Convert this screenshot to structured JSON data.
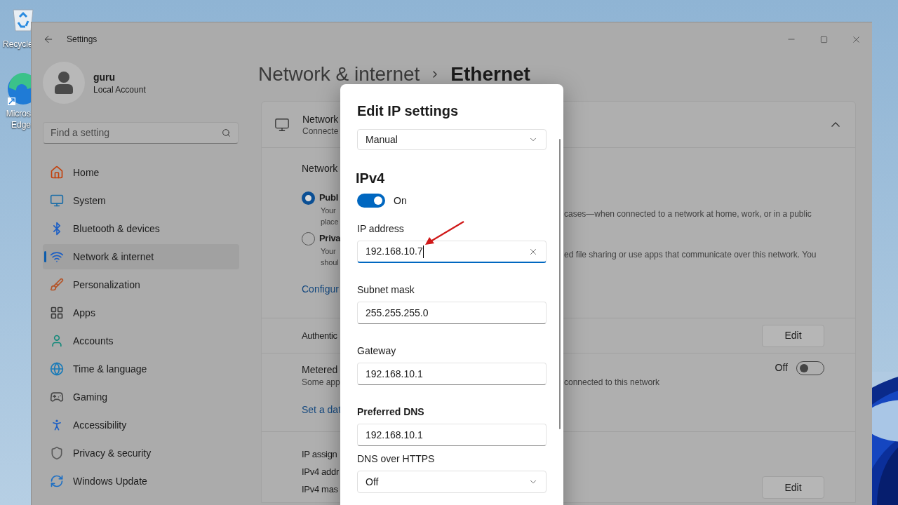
{
  "desktop_icons": [
    {
      "lines": [
        "Recycle"
      ]
    },
    {
      "lines": [
        "Micros",
        "Edge"
      ]
    }
  ],
  "window": {
    "title": "Settings"
  },
  "account": {
    "name": "guru",
    "type": "Local Account"
  },
  "search": {
    "placeholder": "Find a setting"
  },
  "nav": [
    {
      "label": "Home",
      "selected": false
    },
    {
      "label": "System",
      "selected": false
    },
    {
      "label": "Bluetooth & devices",
      "selected": false
    },
    {
      "label": "Network & internet",
      "selected": true
    },
    {
      "label": "Personalization",
      "selected": false
    },
    {
      "label": "Apps",
      "selected": false
    },
    {
      "label": "Accounts",
      "selected": false
    },
    {
      "label": "Time & language",
      "selected": false
    },
    {
      "label": "Gaming",
      "selected": false
    },
    {
      "label": "Accessibility",
      "selected": false
    },
    {
      "label": "Privacy & security",
      "selected": false
    },
    {
      "label": "Windows Update",
      "selected": false
    }
  ],
  "breadcrumb": {
    "parent": "Network & internet",
    "current": "Ethernet"
  },
  "ethernet_card": {
    "header": {
      "title": "Network",
      "subtitle": "Connecte",
      "expanded": true
    },
    "profile": {
      "label": "Network",
      "options": [
        {
          "title": "Publ",
          "lines": [
            "Your",
            "place"
          ],
          "right_text": "cases—when connected to a network at home, work, or in a public",
          "selected": true
        },
        {
          "title": "Priva",
          "lines": [
            "Your",
            "shoul"
          ],
          "right_text": "ed file sharing or use apps that communicate over this network. You",
          "selected": false
        }
      ],
      "link": "Configur"
    },
    "authentication": {
      "label": "Authentic",
      "button": "Edit"
    },
    "metered": {
      "label": "Metered",
      "description": "Some app",
      "right_text": "connected to this network",
      "state_label": "Off",
      "on": false,
      "link": "Set a dat"
    },
    "ip": {
      "labels": [
        "IP assign",
        "IPv4 addr",
        "IPv4 mas"
      ],
      "button": "Edit"
    }
  },
  "dialog": {
    "title": "Edit IP settings",
    "mode": "Manual",
    "section": "IPv4",
    "ipv4": {
      "on": true,
      "state_label": "On"
    },
    "fields": [
      {
        "label": "IP address",
        "value": "192.168.10.7",
        "focused": true,
        "bold": false
      },
      {
        "label": "Subnet mask",
        "value": "255.255.255.0",
        "focused": false,
        "bold": false
      },
      {
        "label": "Gateway",
        "value": "192.168.10.1",
        "focused": false,
        "bold": false
      },
      {
        "label": "Preferred DNS",
        "value": "192.168.10.1",
        "focused": false,
        "bold": true
      }
    ],
    "dns_over_https": {
      "label": "DNS over HTTPS",
      "value": "Off"
    }
  }
}
